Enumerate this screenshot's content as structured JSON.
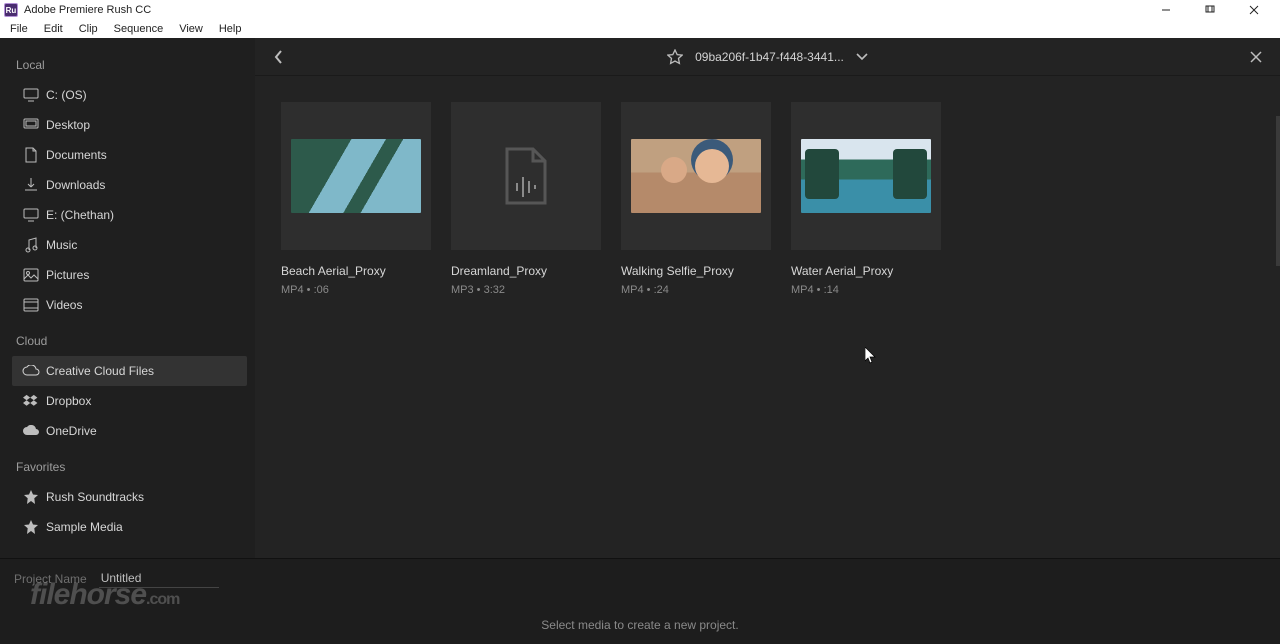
{
  "window": {
    "title": "Adobe Premiere Rush CC"
  },
  "menu": [
    "File",
    "Edit",
    "Clip",
    "Sequence",
    "View",
    "Help"
  ],
  "sidebar": {
    "sections": [
      {
        "label": "Local",
        "items": [
          {
            "icon": "monitor",
            "label": "C: (OS)"
          },
          {
            "icon": "desktop",
            "label": "Desktop"
          },
          {
            "icon": "document",
            "label": "Documents"
          },
          {
            "icon": "download",
            "label": "Downloads"
          },
          {
            "icon": "monitor",
            "label": "E: (Chethan)"
          },
          {
            "icon": "music",
            "label": "Music"
          },
          {
            "icon": "picture",
            "label": "Pictures"
          },
          {
            "icon": "video",
            "label": "Videos"
          }
        ]
      },
      {
        "label": "Cloud",
        "items": [
          {
            "icon": "cc",
            "label": "Creative Cloud Files",
            "active": true
          },
          {
            "icon": "dropbox",
            "label": "Dropbox"
          },
          {
            "icon": "cloud",
            "label": "OneDrive"
          }
        ]
      },
      {
        "label": "Favorites",
        "items": [
          {
            "icon": "star",
            "label": "Rush Soundtracks"
          },
          {
            "icon": "star",
            "label": "Sample Media"
          }
        ]
      }
    ]
  },
  "topbar": {
    "path": "09ba206f-1b47-f448-3441..."
  },
  "media": [
    {
      "kind": "video",
      "thumb": "beach",
      "title": "Beach Aerial_Proxy",
      "meta": "MP4 • :06"
    },
    {
      "kind": "audio",
      "thumb": "audio",
      "title": "Dreamland_Proxy",
      "meta": "MP3 • 3:32"
    },
    {
      "kind": "video",
      "thumb": "selfie",
      "title": "Walking Selfie_Proxy",
      "meta": "MP4 • :24"
    },
    {
      "kind": "video",
      "thumb": "water",
      "title": "Water Aerial_Proxy",
      "meta": "MP4 • :14"
    }
  ],
  "bottom": {
    "projectNameLabel": "Project Name",
    "projectNameValue": "Untitled",
    "hint": "Select media to create a new project."
  },
  "watermark": {
    "a": "filehorse",
    "b": ".com"
  }
}
